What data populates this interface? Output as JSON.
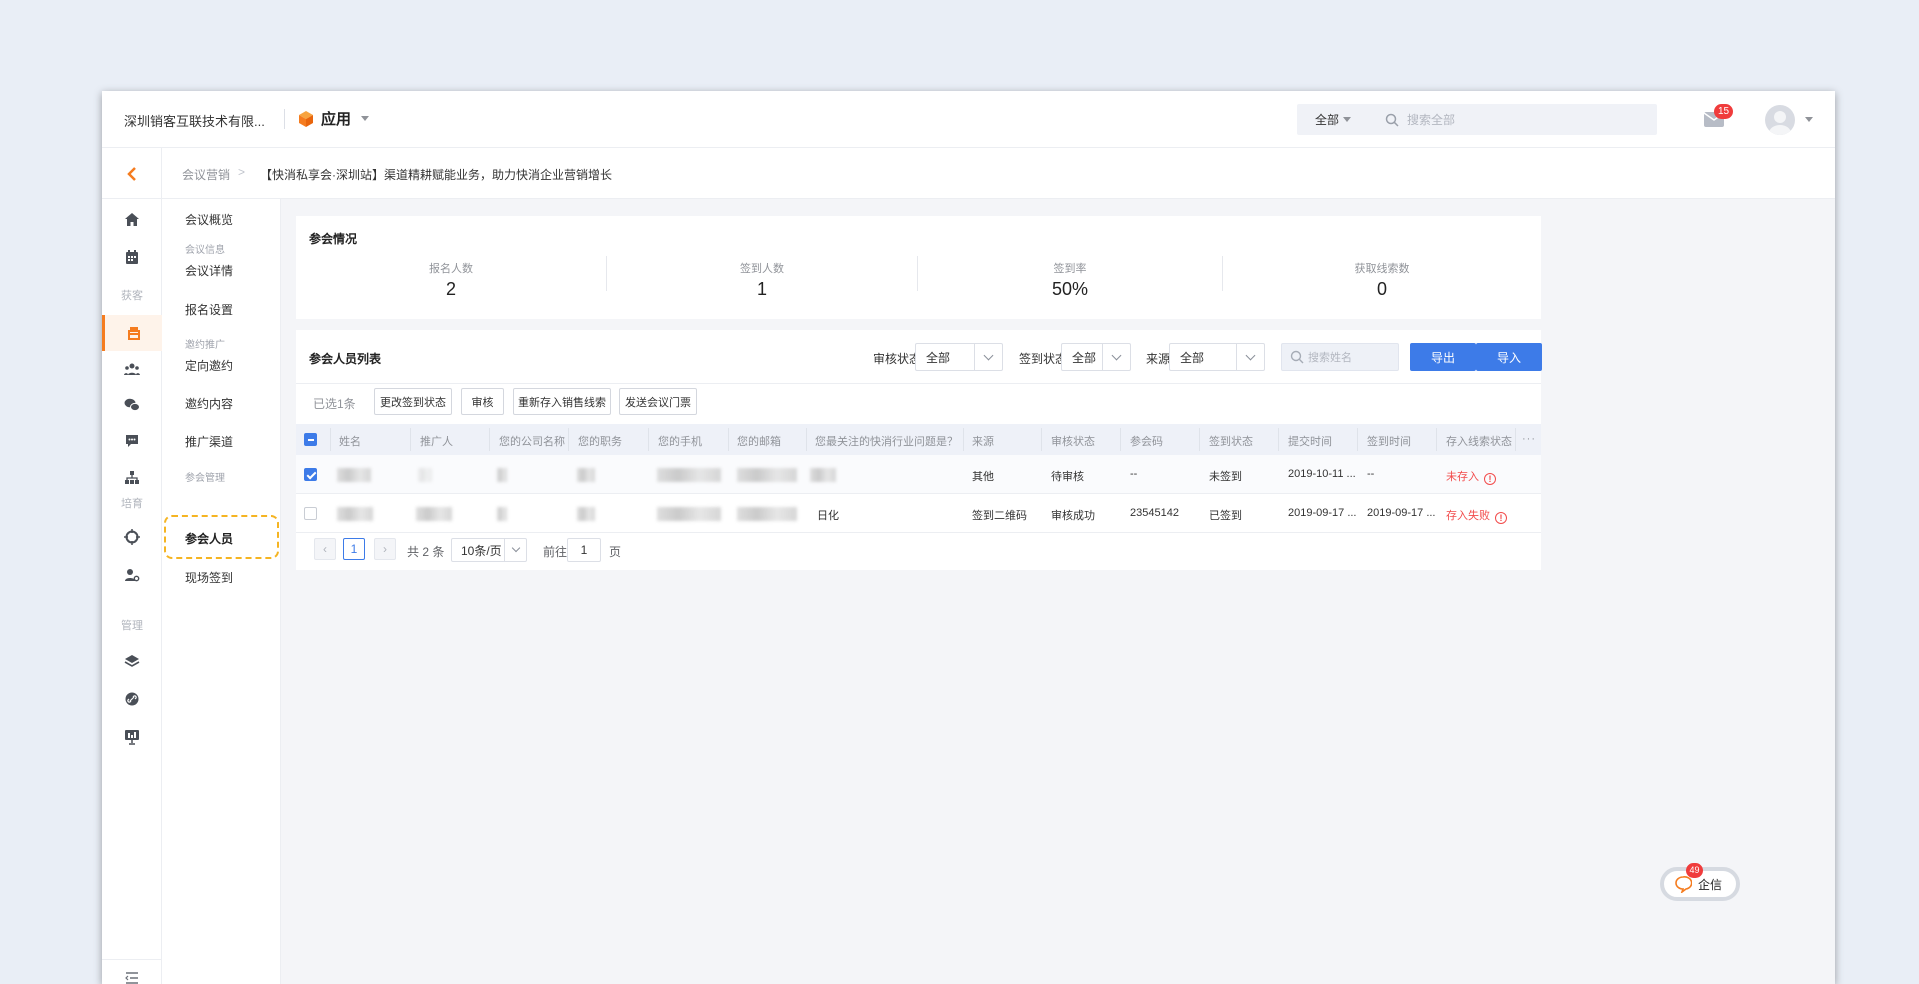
{
  "topbar": {
    "company": "深圳销客互联技术有限...",
    "app_label": "应用",
    "search_scope": "全部",
    "search_placeholder": "搜索全部",
    "message_count": "15"
  },
  "breadcrumb": {
    "parent": "会议营销",
    "current": "【快消私享会·深圳站】渠道精耕赋能业务，助力快消企业营销增长"
  },
  "rail": {
    "groups": [
      "获客",
      "培育",
      "管理"
    ]
  },
  "subnav": {
    "overview": "会议概览",
    "group_info": "会议信息",
    "detail": "会议详情",
    "signup": "报名设置",
    "group_promo": "邀约推广",
    "invite": "定向邀约",
    "invite_content": "邀约内容",
    "channel": "推广渠道",
    "group_manage": "参会管理",
    "attendees": "参会人员",
    "checkin": "现场签到"
  },
  "stats": {
    "title": "参会情况",
    "items": [
      {
        "label": "报名人数",
        "value": "2"
      },
      {
        "label": "签到人数",
        "value": "1"
      },
      {
        "label": "签到率",
        "value": "50%"
      },
      {
        "label": "获取线索数",
        "value": "0"
      }
    ]
  },
  "list": {
    "title": "参会人员列表",
    "filters": [
      {
        "label": "审核状态",
        "value": "全部"
      },
      {
        "label": "签到状态",
        "value": "全部"
      },
      {
        "label": "来源",
        "value": "全部"
      }
    ],
    "search_placeholder": "搜索姓名",
    "export_label": "导出",
    "import_label": "导入",
    "selected_text": "已选1条",
    "actions": [
      "更改签到状态",
      "审核",
      "重新存入销售线索",
      "发送会议门票"
    ],
    "columns": [
      "姓名",
      "推广人",
      "您的公司名称",
      "您的职务",
      "您的手机",
      "您的邮箱",
      "您最关注的快消行业问题是？",
      "来源",
      "审核状态",
      "参会码",
      "签到状态",
      "提交时间",
      "签到时间",
      "存入线索状态"
    ],
    "more": "···",
    "rows": [
      {
        "checked": true,
        "concern": "",
        "source": "其他",
        "audit": "待审核",
        "code": "--",
        "checkin": "未签到",
        "submit": "2019-10-11 ...",
        "checkin_time": "--",
        "lead": "未存入"
      },
      {
        "checked": false,
        "concern": "日化",
        "source": "签到二维码",
        "audit": "审核成功",
        "code": "23545142",
        "checkin": "已签到",
        "submit": "2019-09-17 ...",
        "checkin_time": "2019-09-17 ...",
        "lead": "存入失败"
      }
    ]
  },
  "pager": {
    "current": "1",
    "total_text": "共 2 条",
    "page_size": "10条/页",
    "goto_prefix": "前往",
    "goto_value": "1",
    "goto_suffix": "页"
  },
  "float_chat": {
    "label": "企信",
    "badge": "49"
  },
  "colors": {
    "accent": "#f57c1f",
    "primary": "#3d7be8",
    "danger": "#f24c4c",
    "highlight": "#f5b422"
  }
}
